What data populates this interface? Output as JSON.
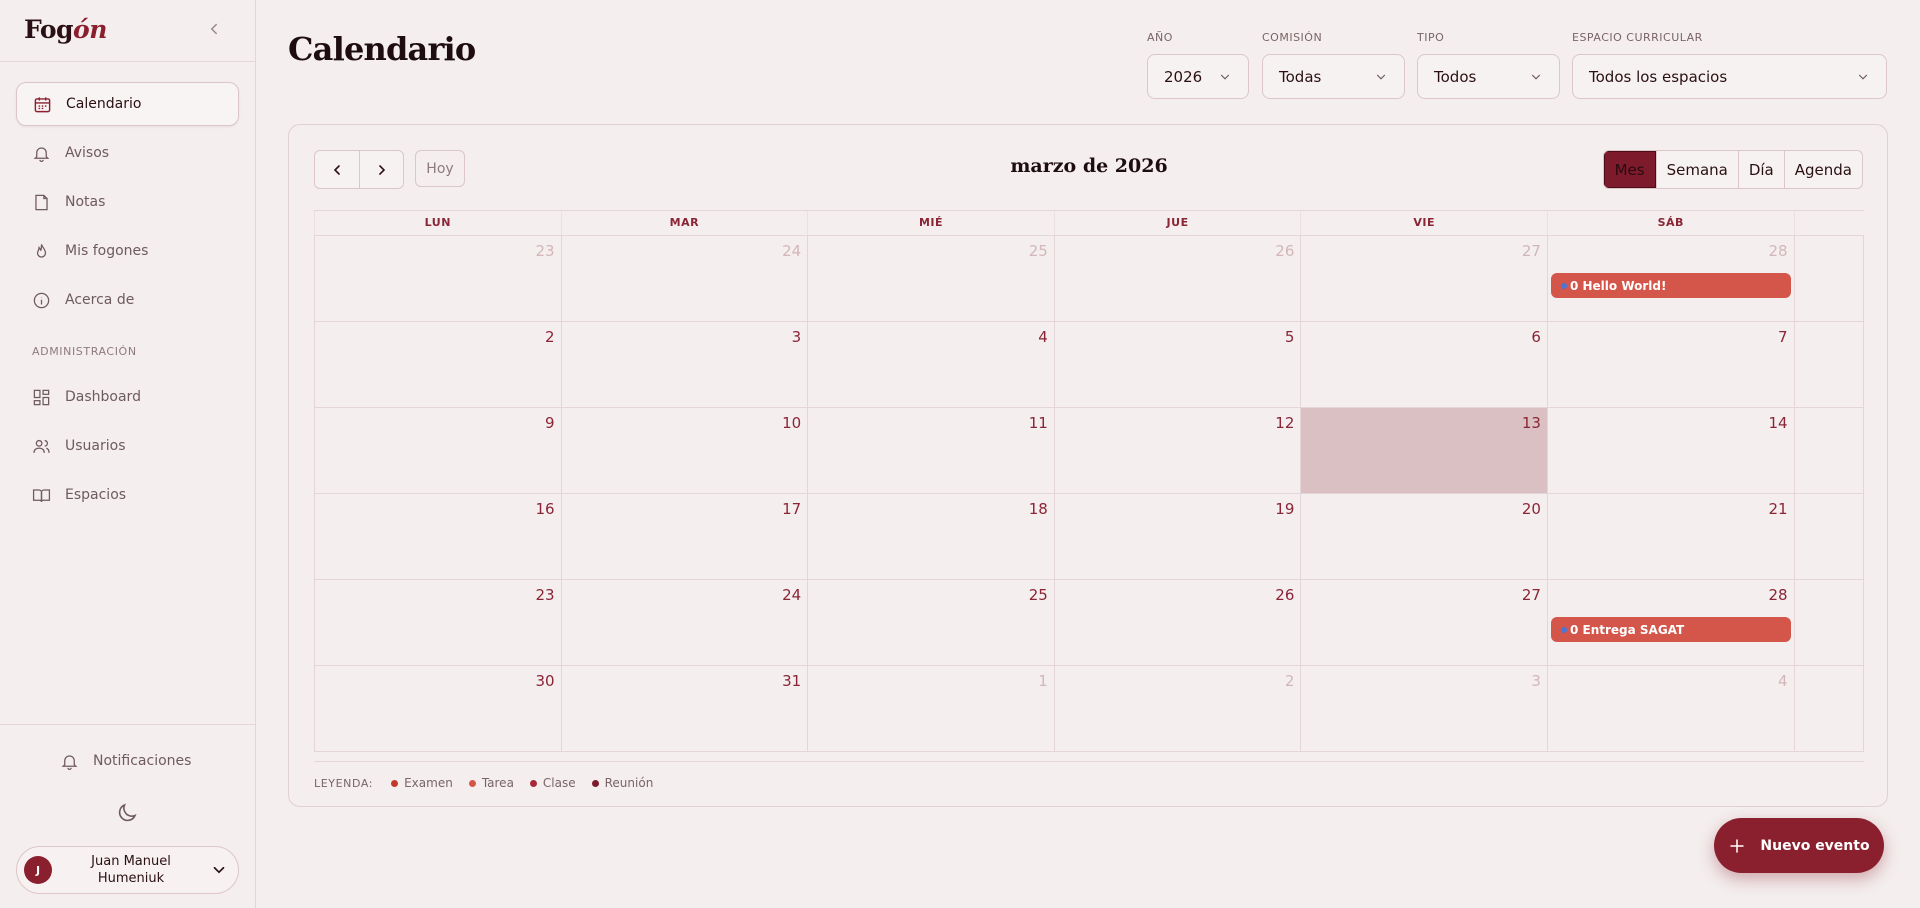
{
  "brand": {
    "prefix": "Fog",
    "accent": "ón"
  },
  "sidebar": {
    "items": [
      {
        "label": "Calendario",
        "icon": "calendar-icon",
        "active": true
      },
      {
        "label": "Avisos",
        "icon": "bell-icon"
      },
      {
        "label": "Notas",
        "icon": "note-icon"
      },
      {
        "label": "Mis fogones",
        "icon": "flame-icon"
      },
      {
        "label": "Acerca de",
        "icon": "info-icon"
      }
    ],
    "admin_label": "ADMINISTRACIÓN",
    "admin_items": [
      {
        "label": "Dashboard",
        "icon": "dashboard-icon"
      },
      {
        "label": "Usuarios",
        "icon": "users-icon"
      },
      {
        "label": "Espacios",
        "icon": "book-icon"
      }
    ],
    "notifications_label": "Notificaciones",
    "user": {
      "initial": "J",
      "name": "Juan Manuel Humeniuk"
    }
  },
  "header": {
    "title": "Calendario",
    "filters": [
      {
        "label": "AÑO",
        "value": "2026"
      },
      {
        "label": "COMISIÓN",
        "value": "Todas"
      },
      {
        "label": "TIPO",
        "value": "Todos"
      },
      {
        "label": "ESPACIO CURRICULAR",
        "value": "Todos los espacios"
      }
    ]
  },
  "calendar": {
    "today_label": "Hoy",
    "month_title": "marzo de 2026",
    "views": [
      "Mes",
      "Semana",
      "Día",
      "Agenda"
    ],
    "active_view": "Mes",
    "weekdays": [
      "LUN",
      "MAR",
      "MIÉ",
      "JUE",
      "VIE",
      "SÁB"
    ],
    "weeks": [
      [
        {
          "n": "23",
          "muted": true
        },
        {
          "n": "24",
          "muted": true
        },
        {
          "n": "25",
          "muted": true
        },
        {
          "n": "26",
          "muted": true
        },
        {
          "n": "27",
          "muted": true
        },
        {
          "n": "28",
          "muted": true,
          "event": "0 Hello World!"
        }
      ],
      [
        {
          "n": "2"
        },
        {
          "n": "3"
        },
        {
          "n": "4"
        },
        {
          "n": "5"
        },
        {
          "n": "6"
        },
        {
          "n": "7"
        }
      ],
      [
        {
          "n": "9"
        },
        {
          "n": "10"
        },
        {
          "n": "11"
        },
        {
          "n": "12"
        },
        {
          "n": "13",
          "today": true
        },
        {
          "n": "14"
        }
      ],
      [
        {
          "n": "16"
        },
        {
          "n": "17"
        },
        {
          "n": "18"
        },
        {
          "n": "19"
        },
        {
          "n": "20"
        },
        {
          "n": "21"
        }
      ],
      [
        {
          "n": "23"
        },
        {
          "n": "24"
        },
        {
          "n": "25"
        },
        {
          "n": "26"
        },
        {
          "n": "27"
        },
        {
          "n": "28",
          "event": "0 Entrega SAGAT"
        }
      ],
      [
        {
          "n": "30"
        },
        {
          "n": "31"
        },
        {
          "n": "1",
          "muted": true
        },
        {
          "n": "2",
          "muted": true
        },
        {
          "n": "3",
          "muted": true
        },
        {
          "n": "4",
          "muted": true
        }
      ]
    ],
    "legend_title": "LEYENDA:",
    "legend": [
      {
        "label": "Examen",
        "color": "#c0392b"
      },
      {
        "label": "Tarea",
        "color": "#d4564a"
      },
      {
        "label": "Clase",
        "color": "#a8283a"
      },
      {
        "label": "Reunión",
        "color": "#7d1a2c"
      }
    ]
  },
  "fab": {
    "label": "Nuevo evento"
  }
}
